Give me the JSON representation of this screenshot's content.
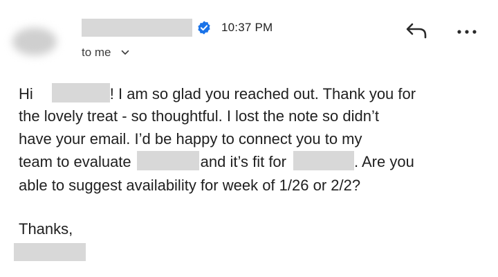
{
  "header": {
    "time": "10:37 PM",
    "recipient_label": "to me",
    "icons": {
      "verified": "verified-badge-icon",
      "reply": "reply-icon",
      "more": "more-options-icon",
      "expand": "chevron-down-icon"
    },
    "accent_color": "#1a73e8"
  },
  "message": {
    "line1_start": "Hi",
    "line1_end": "! I am so glad you reached out. Thank you for",
    "line2": "the lovely treat - so thoughtful. I lost the note so didn’t",
    "line3": "have your email. I’d be happy to connect you to my",
    "line4_start": "team to evaluate",
    "line4_mid": "and it’s fit for",
    "line4_end": ". Are you",
    "line5": "able to suggest availability for week of 1/26 or 2/2?",
    "closing": "Thanks,"
  }
}
